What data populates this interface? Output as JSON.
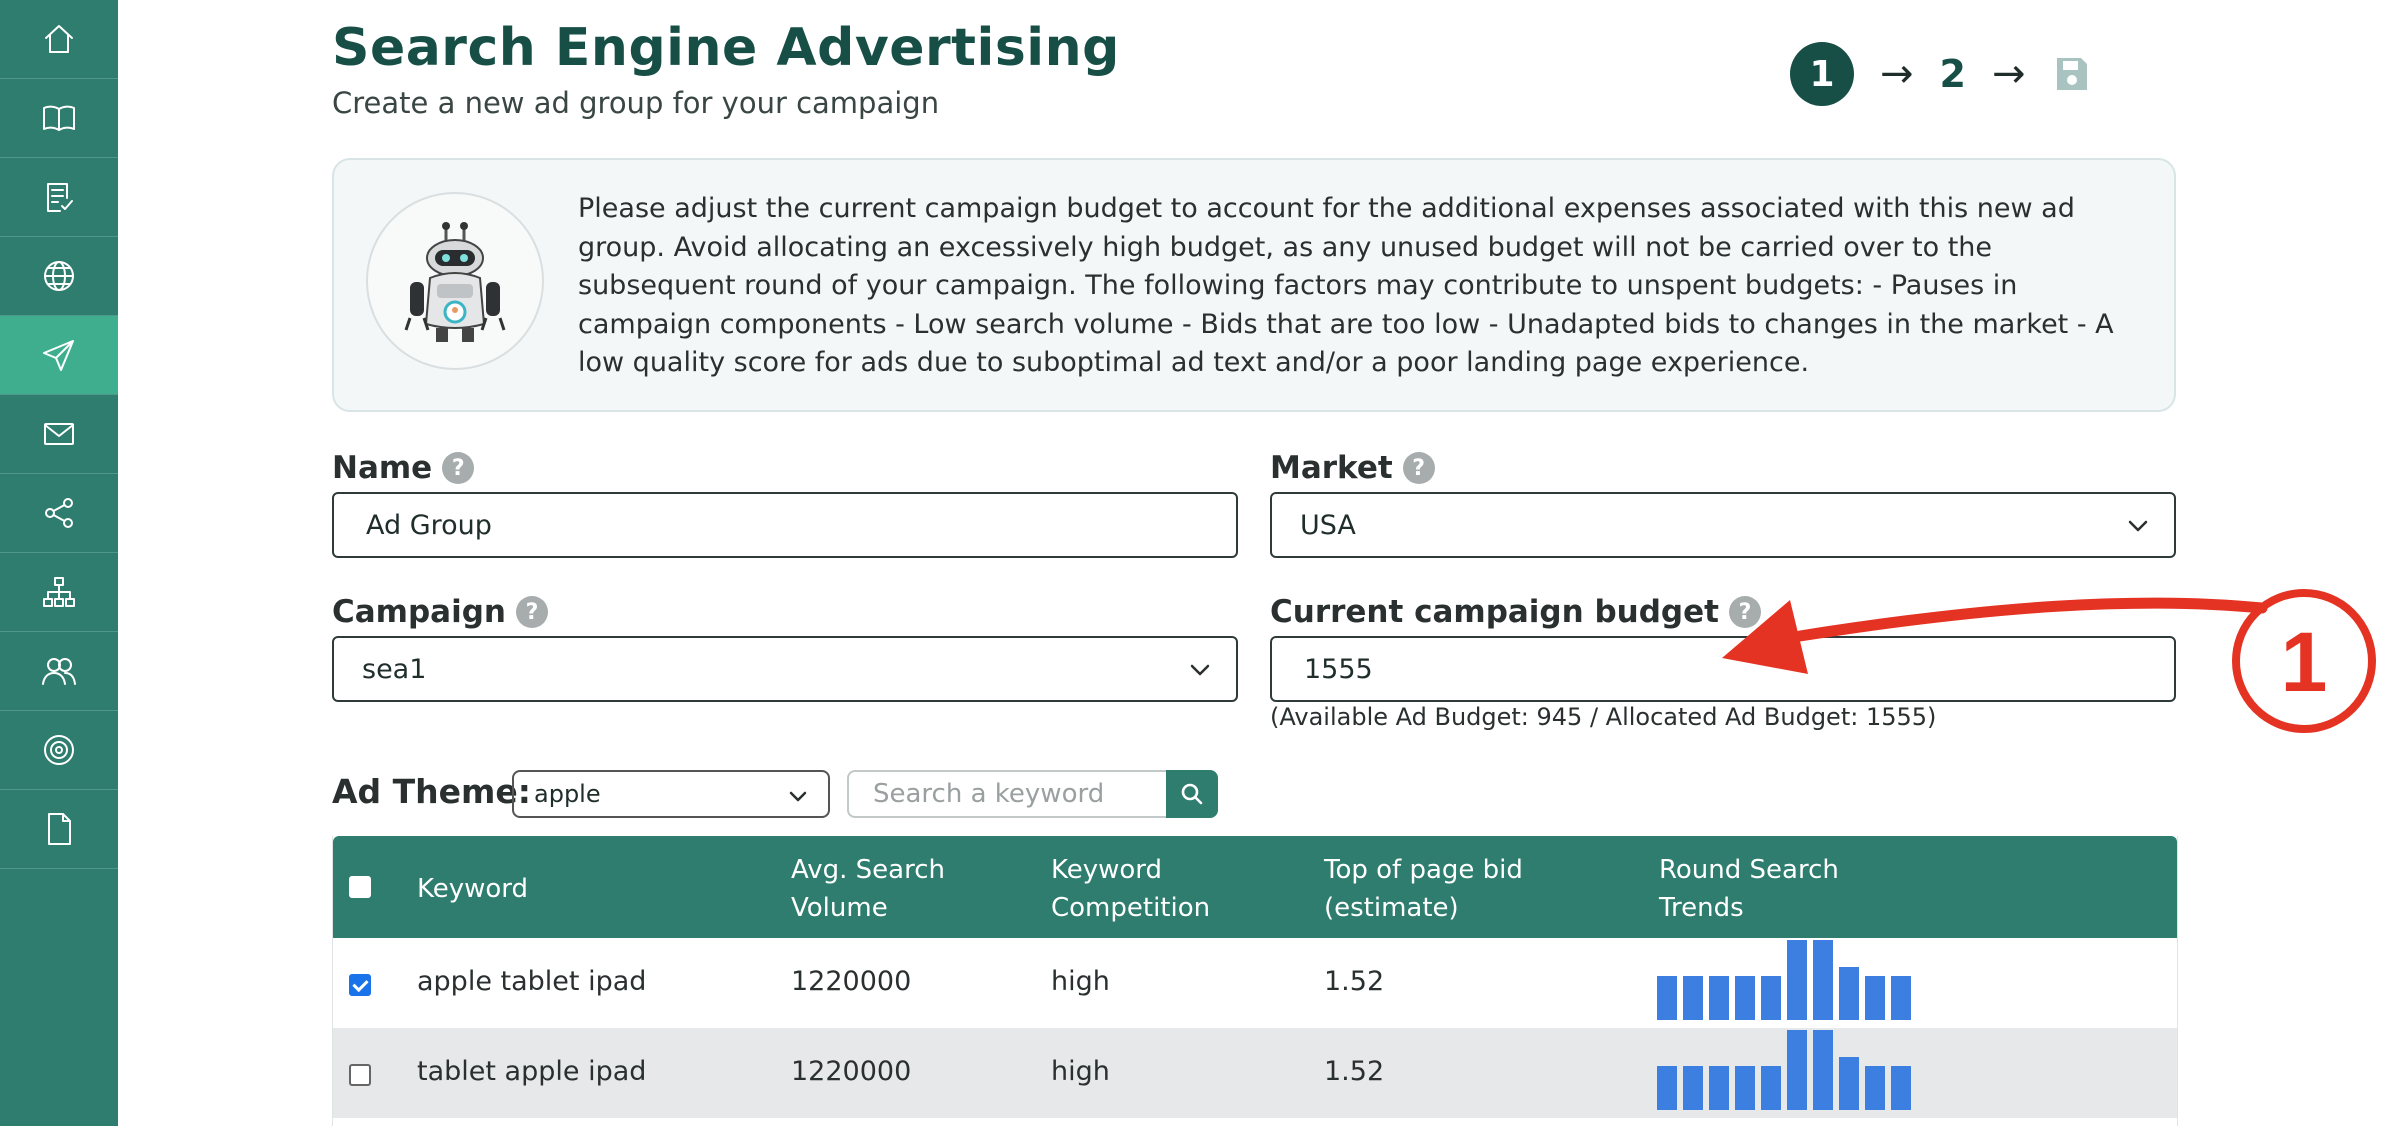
{
  "header": {
    "title": "Search Engine Advertising",
    "subtitle": "Create a new ad group for your campaign",
    "steps": [
      "1",
      "2"
    ],
    "arrow": "→"
  },
  "info": {
    "text": "Please adjust the current campaign budget to account for the additional expenses associated with this new ad group. Avoid allocating an excessively high budget, as any unused budget will not be carried over to the subsequent round of your campaign. The following factors may contribute to unspent budgets: - Pauses in campaign components - Low search volume - Bids that are too low - Unadapted bids to changes in the market - A low quality score for ads due to suboptimal ad text and/or a poor landing page experience."
  },
  "form": {
    "name_label": "Name",
    "name_value": "Ad Group",
    "market_label": "Market",
    "market_value": "USA",
    "campaign_label": "Campaign",
    "campaign_value": "sea1",
    "budget_label": "Current campaign budget",
    "budget_value": "1555",
    "budget_note": "(Available Ad Budget: 945 / Allocated Ad Budget: 1555)",
    "help": "?"
  },
  "ad_theme": {
    "label": "Ad Theme:",
    "value": "apple",
    "search_placeholder": "Search a keyword"
  },
  "table": {
    "headers": {
      "keyword": "Keyword",
      "volume_1": "Avg. Search",
      "volume_2": "Volume",
      "competition_1": "Keyword",
      "competition_2": "Competition",
      "bid_1": "Top of page bid",
      "bid_2": "(estimate)",
      "trends_1": "Round Search",
      "trends_2": "Trends"
    },
    "rows": [
      {
        "keyword": "apple tablet ipad",
        "volume": "1220000",
        "competition": "high",
        "bid": "1.52",
        "checked": true,
        "trend": [
          0.55,
          0.55,
          0.55,
          0.55,
          0.55,
          1.0,
          1.0,
          0.66,
          0.55,
          0.55
        ]
      },
      {
        "keyword": "tablet apple ipad",
        "volume": "1220000",
        "competition": "high",
        "bid": "1.52",
        "checked": false,
        "trend": [
          0.55,
          0.55,
          0.55,
          0.55,
          0.55,
          1.0,
          1.0,
          0.66,
          0.55,
          0.55
        ]
      }
    ]
  },
  "annotation": {
    "label": "1",
    "color": "#e53323"
  },
  "colors": {
    "sidebar": "#2e7d6e",
    "sidebar_active": "#3fae8f",
    "title": "#174f47",
    "trend_bar": "#3d7fe0",
    "row_alt": "#e6e8e9"
  },
  "sidebar": {
    "icons": [
      "home-icon",
      "book-icon",
      "checklist-icon",
      "globe-icon",
      "send-icon",
      "mail-icon",
      "share-icon",
      "org-chart-icon",
      "users-icon",
      "target-icon",
      "document-icon"
    ],
    "active_index": 4
  }
}
